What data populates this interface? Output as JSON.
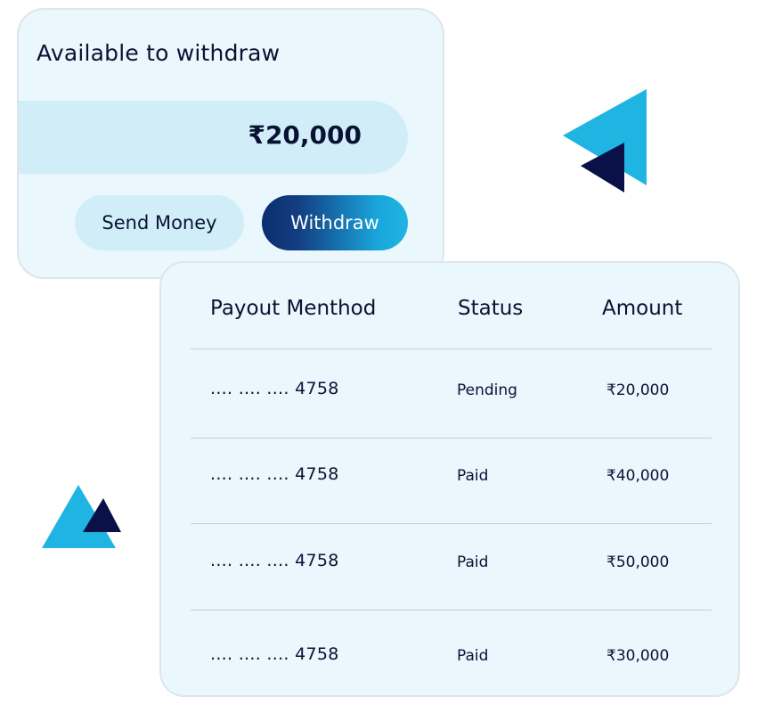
{
  "withdraw_card": {
    "title": "Available to withdraw",
    "balance": "₹20,000",
    "send_money_label": "Send Money",
    "withdraw_label": "Withdraw"
  },
  "payout_table": {
    "headers": {
      "method": "Payout Menthod",
      "status": "Status",
      "amount": "Amount"
    },
    "rows": [
      {
        "method": ".... .... .... 4758",
        "status": "Pending",
        "amount": "₹20,000"
      },
      {
        "method": ".... .... .... 4758",
        "status": "Paid",
        "amount": "₹40,000"
      },
      {
        "method": ".... .... .... 4758",
        "status": "Paid",
        "amount": "₹50,000"
      },
      {
        "method": ".... .... .... 4758",
        "status": "Paid",
        "amount": "₹30,000"
      }
    ]
  },
  "colors": {
    "card_bg": "#eaf7fc",
    "balance_bar": "#d1eef8",
    "navy": "#0a1233",
    "sky": "#1fb4e2"
  },
  "icons": {
    "top_right": "paper-plane-triangles-icon",
    "bottom_left": "mountain-triangles-icon"
  }
}
